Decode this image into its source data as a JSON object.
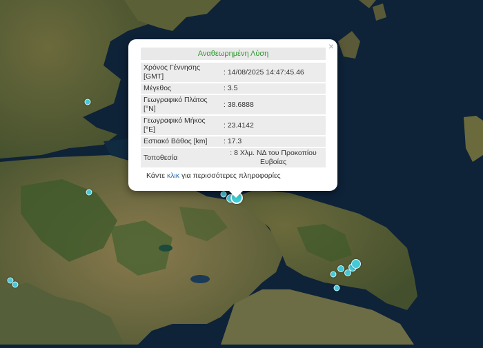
{
  "popup": {
    "title": "Αναθεωρημένη Λύση",
    "close_symbol": "×",
    "rows": [
      {
        "label": "Χρόνος Γέννησης [GMT]",
        "value": ": 14/08/2025 14:47:45.46"
      },
      {
        "label": "Μέγεθος",
        "value": ": 3.5"
      },
      {
        "label": "Γεωγραφικό Πλάτος [°N]",
        "value": ": 38.6888"
      },
      {
        "label": "Γεωγραφικό Μήκος [°E]",
        "value": ": 23.4142"
      },
      {
        "label": "Εστιακό Βάθος [km]",
        "value": ": 17.3"
      },
      {
        "label": "Τοποθεσία",
        "value": ": 8 Χλμ. ΝΔ του Προκοπίου Ευβοίας"
      }
    ],
    "more_prefix": "Κάντε ",
    "more_link": "κλικ",
    "more_suffix": " για περισσότερες πληροφορίες"
  },
  "colors": {
    "sea": "#0e2238",
    "land": "#4d5a33",
    "quake_marker": "#45c9d6",
    "title_text": "#2f9a2f",
    "link_text": "#2a6ebc"
  },
  "icons": {
    "close": "close-icon",
    "marker": "earthquake-marker-icon"
  }
}
